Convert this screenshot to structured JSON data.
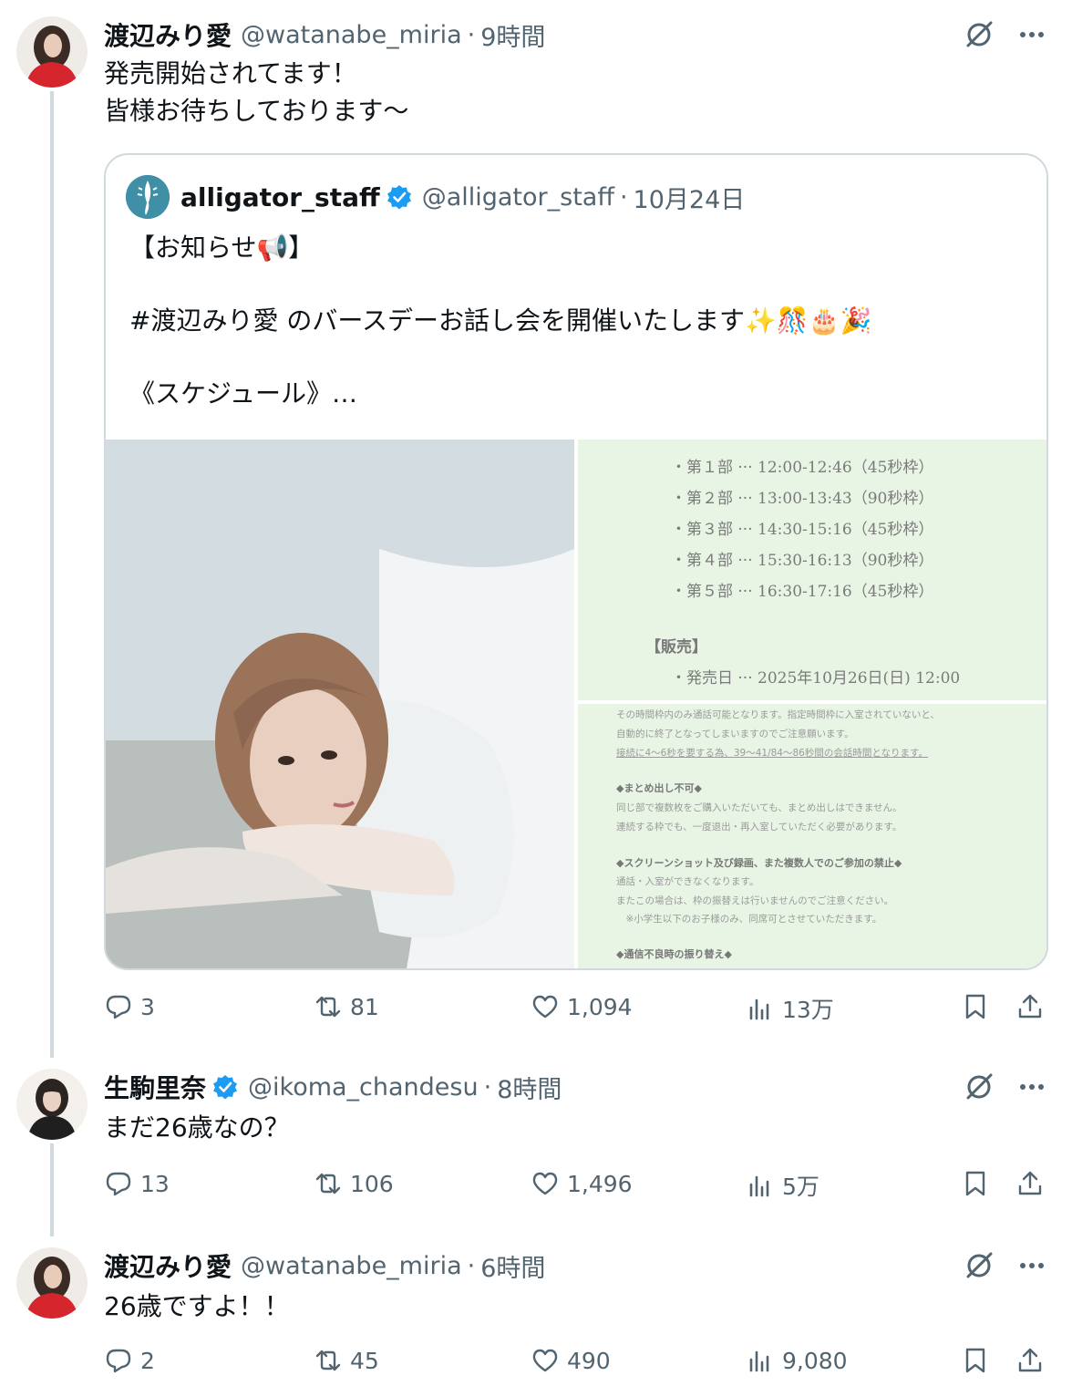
{
  "tweets": [
    {
      "name": "渡辺みり愛",
      "handle": "@watanabe_miria",
      "sep": "·",
      "time": "9時間",
      "text": "発売開始されてます！\n皆様お待ちしております〜",
      "quote": {
        "name": "alligator_staff",
        "handle": "@alligator_staff",
        "sep": "·",
        "time": "10月24日",
        "text": "【お知らせ📢】\n\n#渡辺みり愛 のバースデーお話し会を開催いたします✨🎊🎂🎉\n\n《スケジュール》…",
        "schedule": {
          "rows": [
            "・第１部 ··· 12:00-12:46（45秒枠）",
            "・第２部 ··· 13:00-13:43（90秒枠）",
            "・第３部 ··· 14:30-15:16（45秒枠）",
            "・第４部 ··· 15:30-16:13（90秒枠）",
            "・第５部 ··· 16:30-17:16（45秒枠）"
          ],
          "sales_head": "【販売】",
          "sales_row": "・発売日 ··· 2025年10月26日(日) 12:00"
        },
        "rules": {
          "lines1": [
            "その時間枠内のみ通話可能となります。指定時間枠に入室されていないと、",
            "自動的に終了となってしまいますのでご注意願います。",
            "接続に4〜6秒を要する為、39〜41/84〜86秒間の会話時間となります。"
          ],
          "head2": "◆まとめ出し不可◆",
          "lines2": [
            "同じ部で複数枚をご購入いただいても、まとめ出しはできません。",
            "連続する枠でも、一度退出・再入室していただく必要があります。"
          ],
          "head3": "◆スクリーンショット及び録画、また複数人でのご参加の禁止◆",
          "lines3": [
            "通話・入室ができなくなります。",
            "またこの場合は、枠の振替えは行いませんのでご注意ください。",
            "　※小学生以下のお子様のみ、同席可とさせていただきます。"
          ],
          "head4": "◆通信不良時の振り替え◆"
        }
      },
      "stats": {
        "replies": "3",
        "reposts": "81",
        "likes": "1,094",
        "views": "13万"
      }
    },
    {
      "name": "生駒里奈",
      "handle": "@ikoma_chandesu",
      "sep": "·",
      "time": "8時間",
      "text": "まだ26歳なの？",
      "stats": {
        "replies": "13",
        "reposts": "106",
        "likes": "1,496",
        "views": "5万"
      }
    },
    {
      "name": "渡辺みり愛",
      "handle": "@watanabe_miria",
      "sep": "·",
      "time": "6時間",
      "text": "26歳ですよ！！",
      "stats": {
        "replies": "2",
        "reposts": "45",
        "likes": "490",
        "views": "9,080"
      }
    }
  ],
  "icons": {
    "reply": "reply-icon",
    "repost": "repost-icon",
    "like": "heart-icon",
    "views": "analytics-icon",
    "bookmark": "bookmark-icon",
    "share": "share-icon",
    "grok": "grok-icon",
    "more": "more-icon",
    "verified": "verified-badge-icon"
  },
  "colors": {
    "text": "#0f1419",
    "secondary": "#536471",
    "border": "#cfd9de",
    "verified": "#1d9bf0",
    "schedule_bg": "#e8f5e4"
  }
}
